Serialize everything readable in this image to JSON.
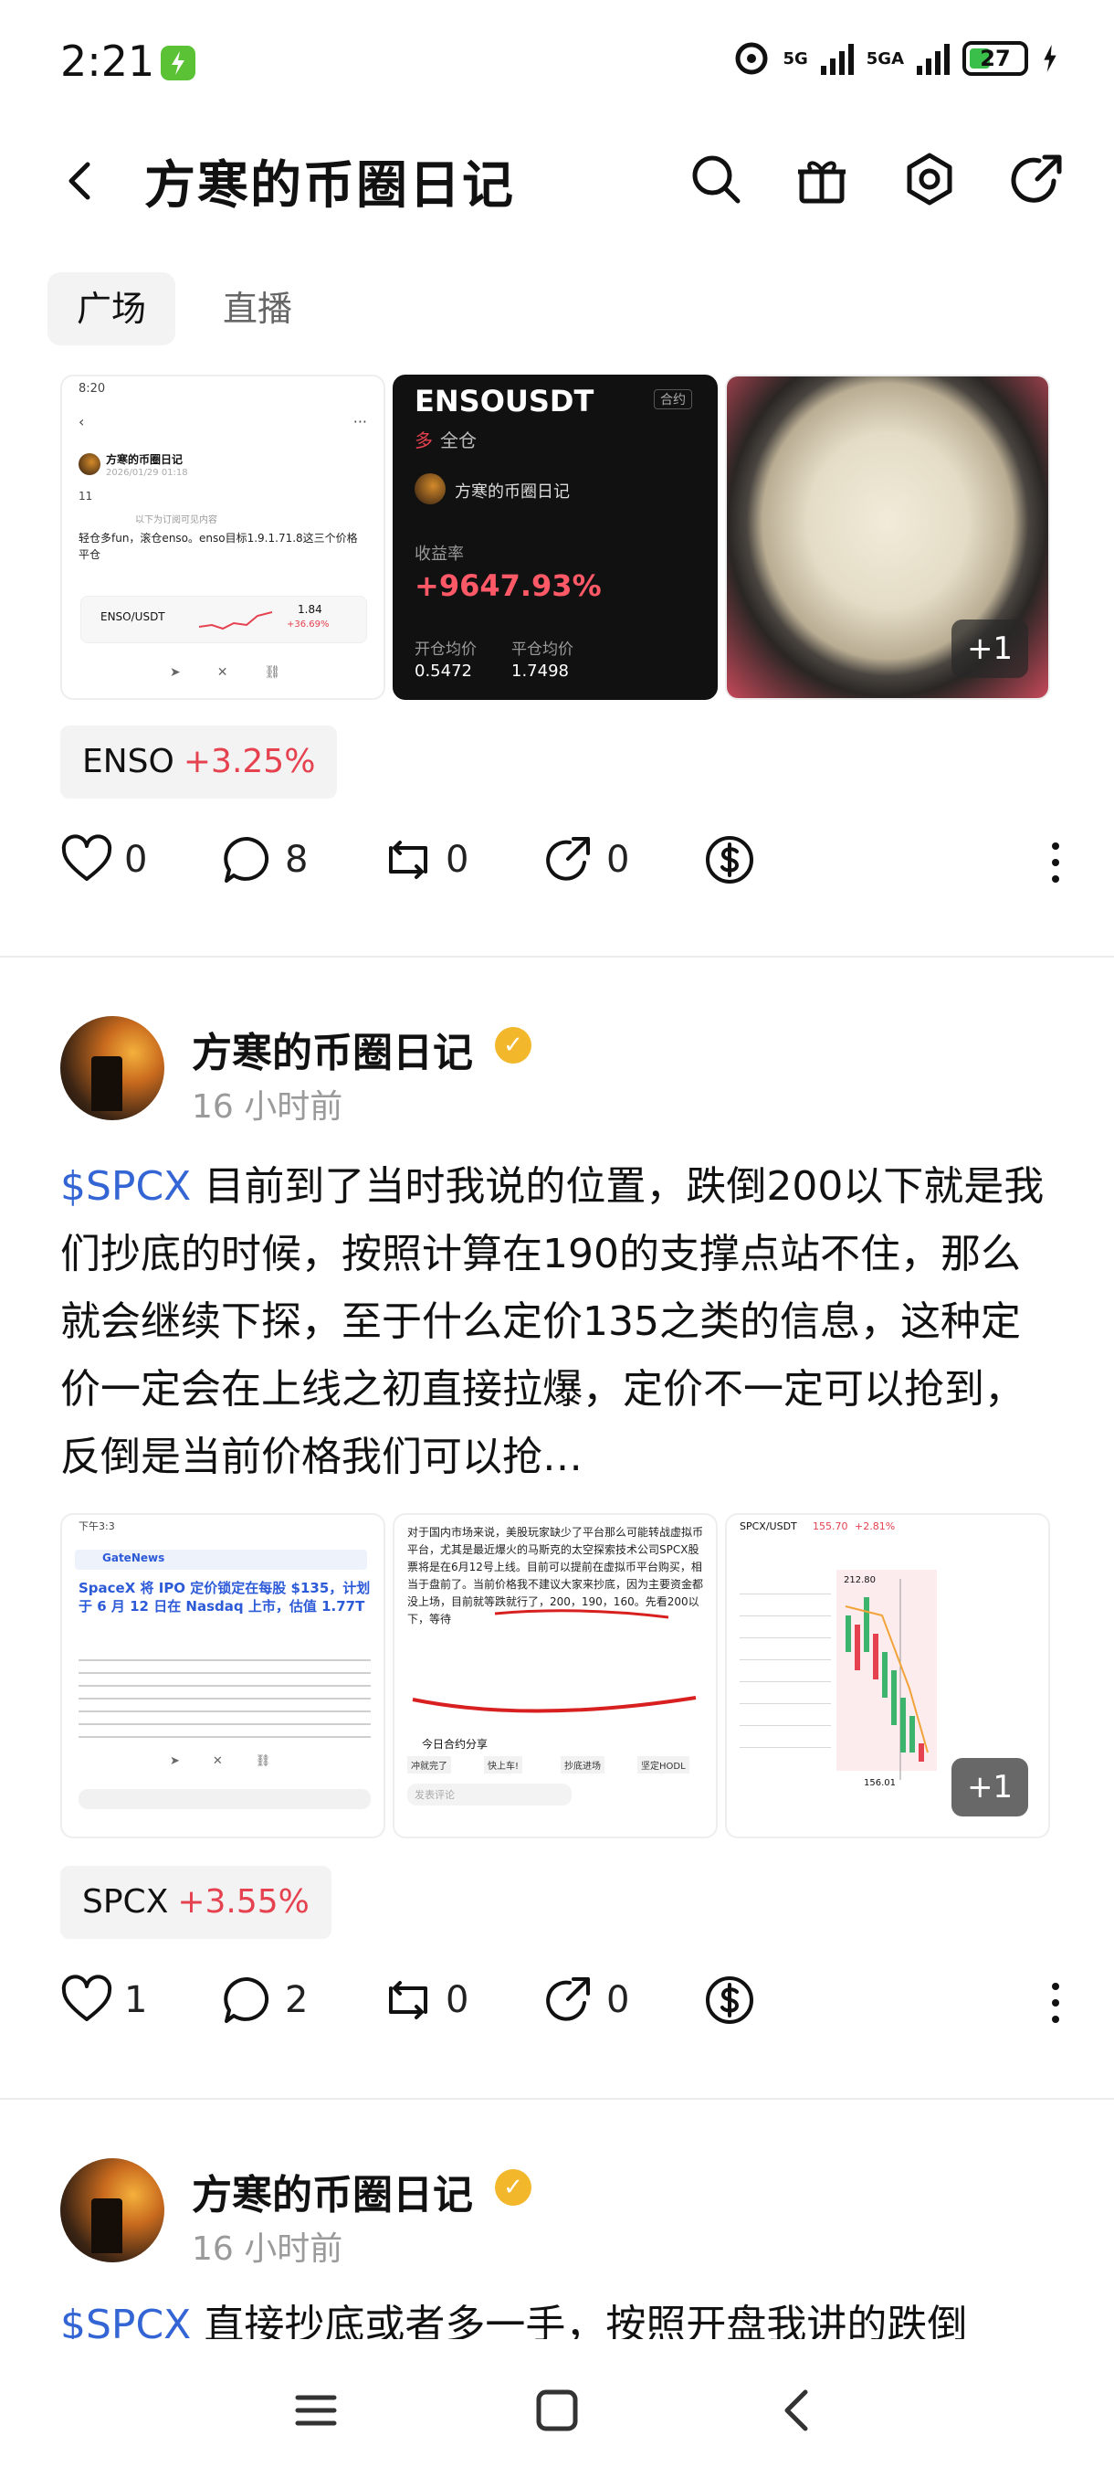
{
  "status": {
    "time": "2:21",
    "net1": "5G",
    "net2": "5GA",
    "battery": "27"
  },
  "header": {
    "title": "方寒的币圈日记"
  },
  "tabs": [
    {
      "label": "广场"
    },
    {
      "label": "直播"
    }
  ],
  "post1": {
    "card1": {
      "time": "8:20",
      "author": "方寒的币圈日记",
      "date": "2026/01/29 01:18",
      "body1": "11",
      "divider": "以下为订阅可见内容",
      "body2": "轻仓多fun，滚仓enso。enso目标1.9.1.71.8这三个价格平仓",
      "ticker": "ENSO/USDT",
      "price": "1.84",
      "change": "+36.69%"
    },
    "card2": {
      "pair": "ENSOUSDT",
      "tag": "合约",
      "side": "多",
      "mode": "全仓",
      "author": "方寒的币圈日记",
      "yield_label": "收益率",
      "yield": "+9647.93%",
      "open_label": "开仓均价",
      "open": "0.5472",
      "close_label": "平仓均价",
      "close": "1.7498"
    },
    "more_count": "+1",
    "chip": {
      "symbol": "ENSO",
      "change": "+3.25%"
    },
    "actions": {
      "likes": "0",
      "comments": "8",
      "reposts": "0",
      "shares": "0"
    }
  },
  "post2": {
    "author": "方寒的币圈日记",
    "time": "16 小时前",
    "tag": "$SPCX",
    "text": "目前到了当时我说的位置，跌倒200以下就是我们抄底的时候，按照计算在190的支撑点站不住，那么就会继续下探，至于什么定价135之类的信息，这种定价一定会在上线之初直接拉爆，定价不一定可以抢到，反倒是当前价格我们可以抢…",
    "img1": {
      "time": "下午3:3",
      "source": "GateNews",
      "headline": "SpaceX 将 IPO 定价锁定在每股 $135，计划于 6 月 12 日在 Nasdaq 上市，估值 1.77T"
    },
    "img2": {
      "text": "对于国内市场来说，美股玩家缺少了平台那么可能转战虚拟币平台，尤其是最近爆火的马斯克的太空探索技术公司SPCX股票将是在6月12号上线。目前可以提前在虚拟币平台购买，相当于盘前了。当前价格我不建议大家来抄底，因为主要资金都没上场，目前就等跌就行了，200，190，160。先看200以下，等待",
      "share": "今日合约分享",
      "btn1": "冲就完了",
      "btn2": "快上车!",
      "btn3": "抄底进场",
      "btn4": "坚定HODL",
      "comment": "发表评论"
    },
    "img3": {
      "pair": "SPCX/USDT",
      "price": "155.70",
      "change": "+2.81%",
      "p1": "212.80",
      "p2": "156.01"
    },
    "more_count": "+1",
    "chip": {
      "symbol": "SPCX",
      "change": "+3.55%"
    },
    "actions": {
      "likes": "1",
      "comments": "2",
      "reposts": "0",
      "shares": "0"
    }
  },
  "post3": {
    "author": "方寒的币圈日记",
    "time": "16 小时前",
    "tag": "$SPCX",
    "text": "直接抄底或者多一手，按照开盘我讲的跌倒"
  }
}
